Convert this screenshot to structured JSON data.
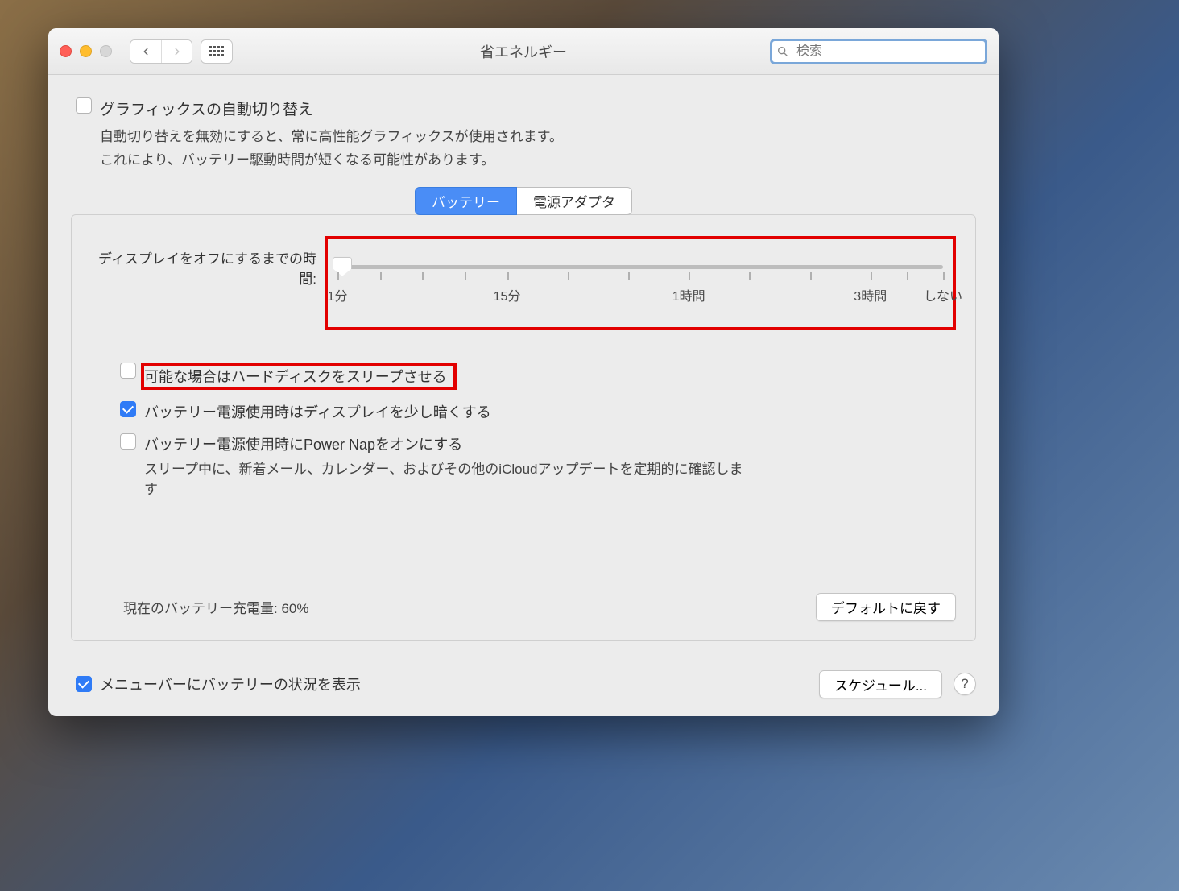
{
  "window": {
    "title": "省エネルギー",
    "search_placeholder": "検索"
  },
  "graphics": {
    "label": "グラフィックスの自動切り替え",
    "sub1": "自動切り替えを無効にすると、常に高性能グラフィックスが使用されます。",
    "sub2": "これにより、バッテリー駆動時間が短くなる可能性があります。"
  },
  "tabs": {
    "battery": "バッテリー",
    "adapter": "電源アダプタ"
  },
  "slider": {
    "label": "ディスプレイをオフにするまでの時間:",
    "ticks": [
      "1分",
      "15分",
      "1時間",
      "3時間",
      "しない"
    ]
  },
  "options": {
    "hdd": "可能な場合はハードディスクをスリープさせる",
    "dim": "バッテリー電源使用時はディスプレイを少し暗くする",
    "powernap": "バッテリー電源使用時にPower Napをオンにする",
    "powernap_sub": "スリープ中に、新着メール、カレンダー、およびその他のiCloudアップデートを定期的に確認します"
  },
  "battery_status": "現在のバッテリー充電量: 60%",
  "buttons": {
    "restore": "デフォルトに戻す",
    "schedule": "スケジュール..."
  },
  "menubar": "メニューバーにバッテリーの状況を表示"
}
